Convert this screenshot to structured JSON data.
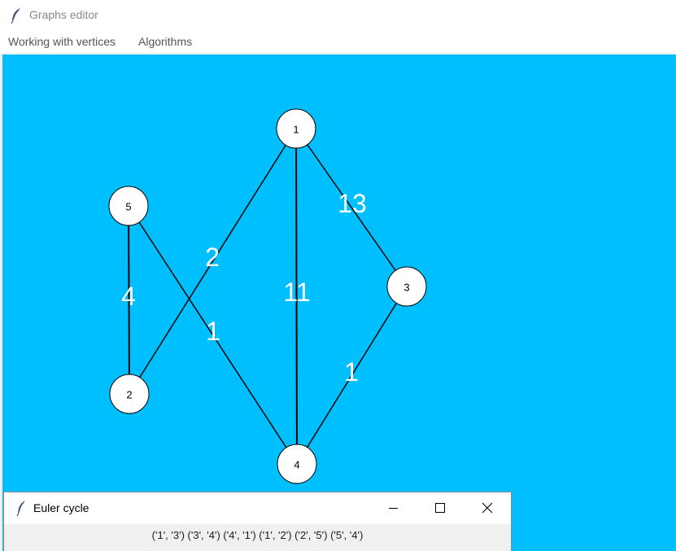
{
  "window": {
    "title": "Graphs editor",
    "icon": "feather-icon"
  },
  "menubar": {
    "items": [
      {
        "label": "Working with vertices"
      },
      {
        "label": "Algorithms"
      }
    ]
  },
  "canvas": {
    "background_color": "#00bfff",
    "edge_label_color": "#ffffff",
    "vertex_fill": "#ffffff",
    "vertex_stroke": "#000000"
  },
  "graph": {
    "vertices": [
      {
        "id": "1",
        "label": "1"
      },
      {
        "id": "2",
        "label": "2"
      },
      {
        "id": "3",
        "label": "3"
      },
      {
        "id": "4",
        "label": "4"
      },
      {
        "id": "5",
        "label": "5"
      }
    ],
    "edges": [
      {
        "from": "1",
        "to": "3",
        "weight": "13"
      },
      {
        "from": "1",
        "to": "4",
        "weight": "11"
      },
      {
        "from": "1",
        "to": "2",
        "weight": "2"
      },
      {
        "from": "5",
        "to": "2",
        "weight": "4"
      },
      {
        "from": "5",
        "to": "4",
        "weight": "1"
      },
      {
        "from": "3",
        "to": "4",
        "weight": "1"
      }
    ]
  },
  "dialog": {
    "title": "Euler cycle",
    "icon": "feather-icon",
    "result_text": "('1', '3') ('3', '4') ('4', '1') ('1', '2') ('2', '5') ('5', '4')",
    "buttons": {
      "minimize": "minimize-icon",
      "maximize": "maximize-icon",
      "close": "close-icon"
    }
  }
}
